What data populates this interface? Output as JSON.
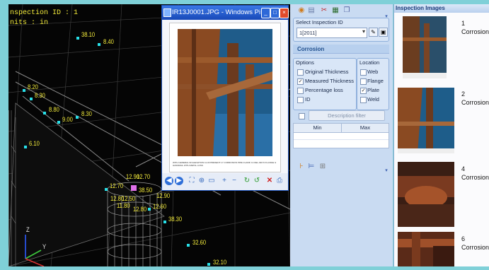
{
  "viewport": {
    "inspection_id_line": "nspection ID : 1",
    "units_line": "nits : in",
    "thickness_labels": [
      "38.10",
      "8.40",
      "8.20",
      "8.30",
      "8.80",
      "8.30",
      "9.00",
      "6.10",
      "12.70",
      "12.90",
      "12.70",
      "38.50",
      "12.80",
      "12.50",
      "11.80",
      "12.60",
      "12.80",
      "12.90",
      "38.30",
      "32.60",
      "32.10"
    ],
    "axis_z": "Z",
    "axis_y": "Y"
  },
  "viewer": {
    "title": "IR13J0001.JPG - Windows Pict...",
    "caption": "WITH GENERAL 90 ELEVATION 11-03 PRESENT LY CORROSION PIPE CLAMP, 14 DEL AIR IN FLANGE & HANDRAIL WITH METAL LOSS"
  },
  "panel": {
    "select_label": "Select Inspection ID",
    "select_value": "1[2011]",
    "section_title": "Corrosion",
    "options_label": "Options",
    "location_label": "Location",
    "options": [
      {
        "label": "Original Thickness",
        "checked": false
      },
      {
        "label": "Measured Thickness",
        "checked": true
      },
      {
        "label": "Percentage loss",
        "checked": false
      },
      {
        "label": "ID",
        "checked": false
      }
    ],
    "locations": [
      {
        "label": "Web",
        "checked": false
      },
      {
        "label": "Flange",
        "checked": false
      },
      {
        "label": "Plate",
        "checked": true
      },
      {
        "label": "Weld",
        "checked": false
      }
    ],
    "description_filter": "Description filter",
    "table_headers": [
      "Min",
      "Max"
    ]
  },
  "images": {
    "header": "Inspection Images",
    "items": [
      {
        "number": "1",
        "type": "Corrosion"
      },
      {
        "number": "2",
        "type": "Corrosion"
      },
      {
        "number": "4",
        "type": "Corrosion"
      },
      {
        "number": "6",
        "type": "Corrosion"
      }
    ]
  }
}
